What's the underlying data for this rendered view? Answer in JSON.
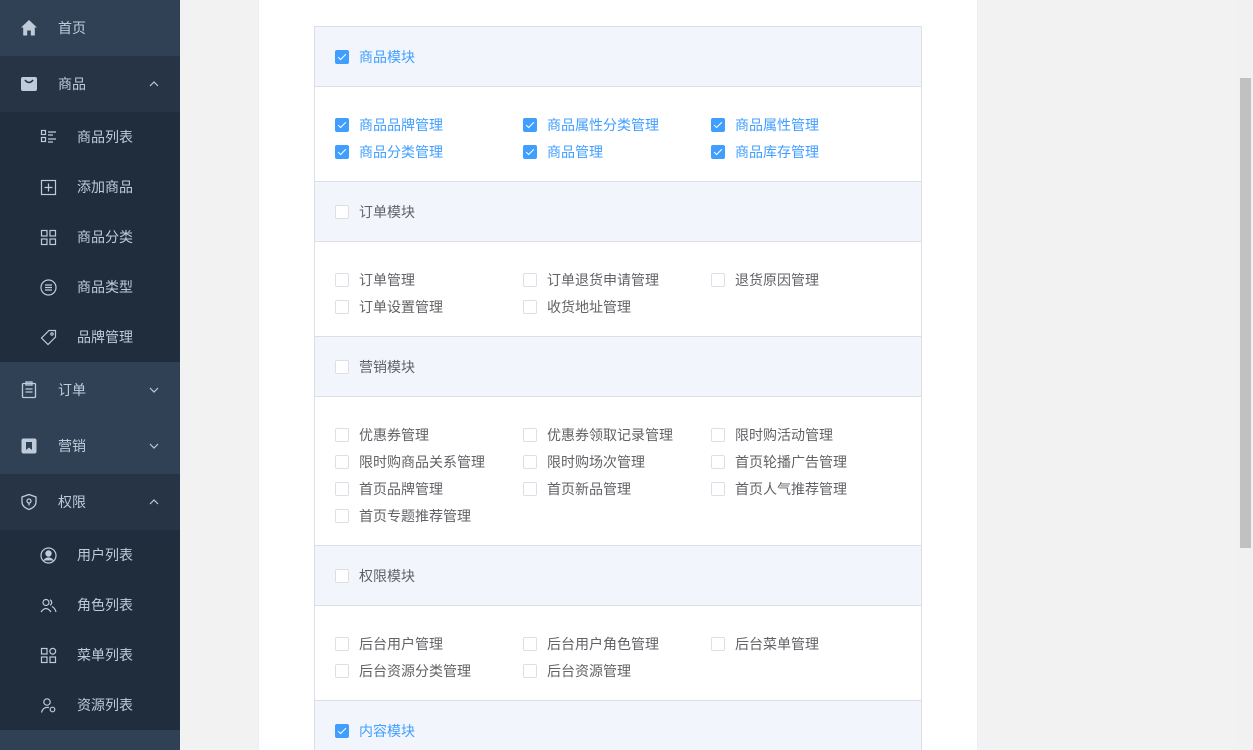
{
  "sidebar": {
    "home": {
      "label": "首页",
      "icon": "home-icon"
    },
    "product": {
      "label": "商品",
      "icon": "shopping-bag-icon"
    },
    "product_items": [
      {
        "label": "商品列表",
        "icon": "list-icon"
      },
      {
        "label": "添加商品",
        "icon": "add-box-icon"
      },
      {
        "label": "商品分类",
        "icon": "grid-icon"
      },
      {
        "label": "商品类型",
        "icon": "circle-list-icon"
      },
      {
        "label": "品牌管理",
        "icon": "tag-icon"
      }
    ],
    "order": {
      "label": "订单",
      "icon": "clipboard-icon"
    },
    "marketing": {
      "label": "营销",
      "icon": "bookmark-icon"
    },
    "permission": {
      "label": "权限",
      "icon": "shield-icon"
    },
    "permission_items": [
      {
        "label": "用户列表",
        "icon": "user-circle-icon"
      },
      {
        "label": "角色列表",
        "icon": "users-icon"
      },
      {
        "label": "菜单列表",
        "icon": "menu-grid-icon"
      },
      {
        "label": "资源列表",
        "icon": "user-settings-icon"
      }
    ]
  },
  "modules": [
    {
      "title": "商品模块",
      "checked": true,
      "items": [
        {
          "label": "商品品牌管理",
          "checked": true
        },
        {
          "label": "商品属性分类管理",
          "checked": true
        },
        {
          "label": "商品属性管理",
          "checked": true
        },
        {
          "label": "商品分类管理",
          "checked": true
        },
        {
          "label": "商品管理",
          "checked": true
        },
        {
          "label": "商品库存管理",
          "checked": true
        }
      ]
    },
    {
      "title": "订单模块",
      "checked": false,
      "items": [
        {
          "label": "订单管理",
          "checked": false
        },
        {
          "label": "订单退货申请管理",
          "checked": false
        },
        {
          "label": "退货原因管理",
          "checked": false
        },
        {
          "label": "订单设置管理",
          "checked": false
        },
        {
          "label": "收货地址管理",
          "checked": false
        }
      ]
    },
    {
      "title": "营销模块",
      "checked": false,
      "items": [
        {
          "label": "优惠券管理",
          "checked": false
        },
        {
          "label": "优惠券领取记录管理",
          "checked": false
        },
        {
          "label": "限时购活动管理",
          "checked": false
        },
        {
          "label": "限时购商品关系管理",
          "checked": false
        },
        {
          "label": "限时购场次管理",
          "checked": false
        },
        {
          "label": "首页轮播广告管理",
          "checked": false
        },
        {
          "label": "首页品牌管理",
          "checked": false
        },
        {
          "label": "首页新品管理",
          "checked": false
        },
        {
          "label": "首页人气推荐管理",
          "checked": false
        },
        {
          "label": "首页专题推荐管理",
          "checked": false
        }
      ]
    },
    {
      "title": "权限模块",
      "checked": false,
      "items": [
        {
          "label": "后台用户管理",
          "checked": false
        },
        {
          "label": "后台用户角色管理",
          "checked": false
        },
        {
          "label": "后台菜单管理",
          "checked": false
        },
        {
          "label": "后台资源分类管理",
          "checked": false
        },
        {
          "label": "后台资源管理",
          "checked": false
        }
      ]
    },
    {
      "title": "内容模块",
      "checked": true,
      "items": []
    }
  ],
  "colors": {
    "sidebar_bg": "#304156",
    "submenu_bg": "#1f2d3d",
    "accent": "#409eff"
  }
}
